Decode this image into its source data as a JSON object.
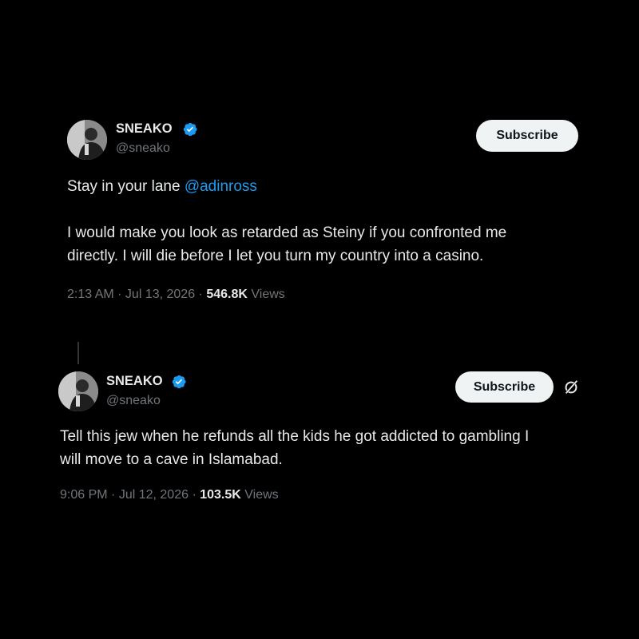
{
  "tweets": [
    {
      "author": {
        "name": "SNEAKO",
        "handle": "@sneako",
        "verified": true
      },
      "subscribe_label": "Subscribe",
      "lines": [
        [
          "Stay in your lane ",
          "@adinross"
        ],
        [
          ""
        ],
        [
          "I would make you look as retarded as Steiny if you confronted me"
        ],
        [
          "directly. I will die before I let you turn my country into a casino."
        ]
      ],
      "time": "2:13 AM",
      "date": "Jul 13, 2026",
      "views_count": "546.8K",
      "views_label": "Views"
    },
    {
      "author": {
        "name": "SNEAKO",
        "handle": "@sneako",
        "verified": true
      },
      "subscribe_label": "Subscribe",
      "lines": [
        [
          "Tell this jew when he refunds all the kids he got addicted to gambling I"
        ],
        [
          "will move to a cave in Islamabad."
        ]
      ],
      "time": "9:06 PM",
      "date": "Jul 12, 2026",
      "views_count": "103.5K",
      "views_label": "Views"
    }
  ],
  "separator": " · ",
  "colors": {
    "background": "#000000",
    "text": "#e7e9ea",
    "secondary": "#71767b",
    "mention": "#1d9bf0",
    "verified": "#1d9bf0",
    "button_bg": "#eff3f4"
  },
  "icons": {
    "verified": "verified-badge-icon",
    "grok": "grok-icon"
  }
}
